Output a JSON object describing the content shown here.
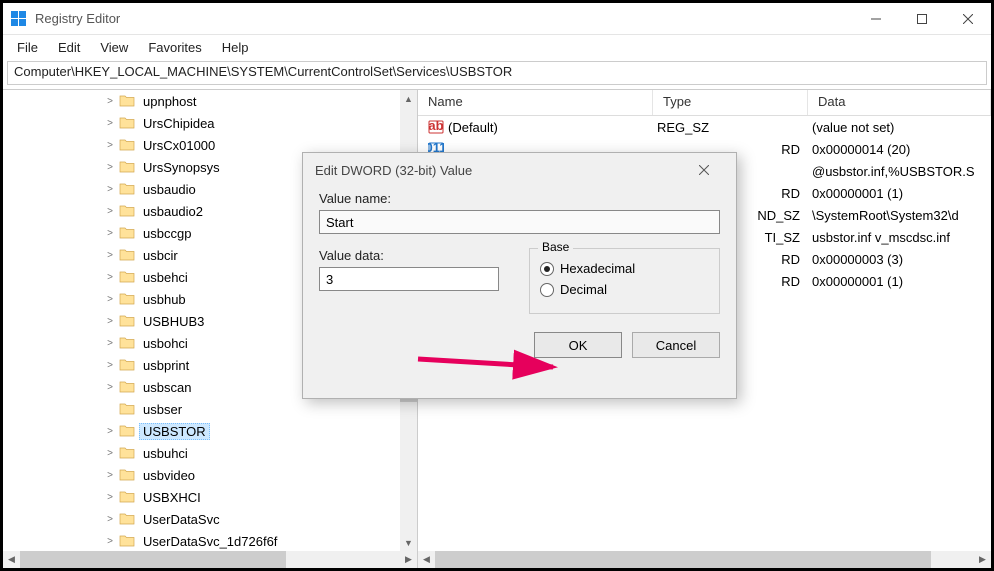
{
  "window": {
    "title": "Registry Editor"
  },
  "menu": {
    "file": "File",
    "edit": "Edit",
    "view": "View",
    "favorites": "Favorites",
    "help": "Help"
  },
  "address": "Computer\\HKEY_LOCAL_MACHINE\\SYSTEM\\CurrentControlSet\\Services\\USBSTOR",
  "tree": {
    "items": [
      {
        "name": "upnphost",
        "expandable": true,
        "selected": false
      },
      {
        "name": "UrsChipidea",
        "expandable": true,
        "selected": false
      },
      {
        "name": "UrsCx01000",
        "expandable": true,
        "selected": false
      },
      {
        "name": "UrsSynopsys",
        "expandable": true,
        "selected": false
      },
      {
        "name": "usbaudio",
        "expandable": true,
        "selected": false
      },
      {
        "name": "usbaudio2",
        "expandable": true,
        "selected": false
      },
      {
        "name": "usbccgp",
        "expandable": true,
        "selected": false
      },
      {
        "name": "usbcir",
        "expandable": true,
        "selected": false
      },
      {
        "name": "usbehci",
        "expandable": true,
        "selected": false
      },
      {
        "name": "usbhub",
        "expandable": true,
        "selected": false
      },
      {
        "name": "USBHUB3",
        "expandable": true,
        "selected": false
      },
      {
        "name": "usbohci",
        "expandable": true,
        "selected": false
      },
      {
        "name": "usbprint",
        "expandable": true,
        "selected": false
      },
      {
        "name": "usbscan",
        "expandable": true,
        "selected": false
      },
      {
        "name": "usbser",
        "expandable": false,
        "selected": false
      },
      {
        "name": "USBSTOR",
        "expandable": true,
        "selected": true
      },
      {
        "name": "usbuhci",
        "expandable": true,
        "selected": false
      },
      {
        "name": "usbvideo",
        "expandable": true,
        "selected": false
      },
      {
        "name": "USBXHCI",
        "expandable": true,
        "selected": false
      },
      {
        "name": "UserDataSvc",
        "expandable": true,
        "selected": false
      },
      {
        "name": "UserDataSvc_1d726f6f",
        "expandable": true,
        "selected": false
      }
    ]
  },
  "list": {
    "headers": {
      "name": "Name",
      "type": "Type",
      "data": "Data"
    },
    "rows": [
      {
        "icon": "string",
        "name": "(Default)",
        "type": "REG_SZ",
        "data": "(value not set)"
      },
      {
        "icon": "dword",
        "name": "",
        "type": "RD",
        "data": "0x00000014 (20)"
      },
      {
        "icon": "string",
        "name": "",
        "type": "",
        "data": "@usbstor.inf,%USBSTOR.S"
      },
      {
        "icon": "dword",
        "name": "",
        "type": "RD",
        "data": "0x00000001 (1)"
      },
      {
        "icon": "string",
        "name": "",
        "type": "ND_SZ",
        "data": "\\SystemRoot\\System32\\d"
      },
      {
        "icon": "string",
        "name": "",
        "type": "TI_SZ",
        "data": "usbstor.inf v_mscdsc.inf"
      },
      {
        "icon": "dword",
        "name": "",
        "type": "RD",
        "data": "0x00000003 (3)"
      },
      {
        "icon": "dword",
        "name": "",
        "type": "RD",
        "data": "0x00000001 (1)"
      }
    ]
  },
  "dialog": {
    "title": "Edit DWORD (32-bit) Value",
    "value_name_label": "Value name:",
    "value_name": "Start",
    "value_data_label": "Value data:",
    "value_data": "3",
    "base_label": "Base",
    "hex_label": "Hexadecimal",
    "dec_label": "Decimal",
    "ok": "OK",
    "cancel": "Cancel"
  }
}
